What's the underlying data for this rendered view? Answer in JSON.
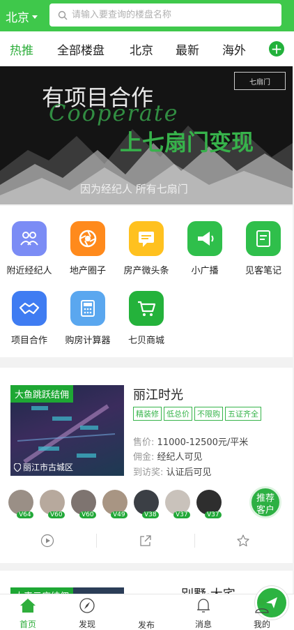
{
  "header": {
    "city": "北京",
    "search_placeholder": "请输入要查询的楼盘名称"
  },
  "tabs": [
    "热推",
    "全部楼盘",
    "北京",
    "最新",
    "海外"
  ],
  "banner": {
    "line1": "有项目合作",
    "line2": "Cooperate",
    "line3": "上七扇门变现",
    "line4": "因为经纪人 所有七扇门",
    "logo": "七扇门"
  },
  "menu": [
    {
      "label": "附近经纪人",
      "color": "#7b8cf5"
    },
    {
      "label": "地产圈子",
      "color": "#ff8a1c"
    },
    {
      "label": "房产微头条",
      "color": "#ffc11f"
    },
    {
      "label": "小广播",
      "color": "#2fbf4b"
    },
    {
      "label": "见客笔记",
      "color": "#2fbf4b"
    },
    {
      "label": "项目合作",
      "color": "#3f7cf2"
    },
    {
      "label": "购房计算器",
      "color": "#5aa7ef"
    },
    {
      "label": "七贝商城",
      "color": "#24b23b"
    }
  ],
  "listing": {
    "tag": "大鱼跳跃结佣",
    "location": "丽江市古城区",
    "title": "丽江时光",
    "chips": [
      "精装修",
      "低总价",
      "不限购",
      "五证齐全"
    ],
    "price_label": "售价:",
    "price": "11000-12500元/平米",
    "commission_label": "佣金:",
    "commission": "经纪人可见",
    "visit_label": "到访奖:",
    "visit": "认证后可见",
    "agents": [
      "V64",
      "V60",
      "V60",
      "V49",
      "V38",
      "V37",
      "V37"
    ],
    "recommend": [
      "推荐",
      "客户"
    ]
  },
  "listing2": {
    "tag": "大麦元店结佣",
    "title": "别墅·大宅"
  },
  "bottom_nav": [
    "首页",
    "发现",
    "发布",
    "消息",
    "我的"
  ]
}
